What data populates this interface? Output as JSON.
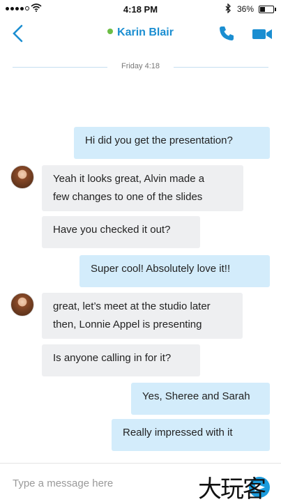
{
  "status_bar": {
    "time": "4:18 PM",
    "battery": "36%",
    "battery_level": 0.36
  },
  "header": {
    "contact_name": "Karin Blair",
    "presence_color": "#6cbd45",
    "accent_color": "#1b8ed1"
  },
  "date_divider": "Friday 4:18",
  "messages": [
    {
      "direction": "outgoing",
      "text": "Hi did you get the presentation?"
    },
    {
      "direction": "incoming",
      "lines": [
        "Yeah it looks great, Alvin made a",
        "few changes to one of the slides"
      ]
    },
    {
      "direction": "incoming",
      "text": "Have you checked it out?"
    },
    {
      "direction": "outgoing",
      "text": "Super cool! Absolutely love it!!"
    },
    {
      "direction": "incoming",
      "lines": [
        "great, let’s meet at the studio later",
        "then, Lonnie Appel is presenting"
      ]
    },
    {
      "direction": "incoming",
      "text": "Is anyone calling in for it?"
    },
    {
      "direction": "outgoing",
      "text": "Yes, Sheree and Sarah"
    },
    {
      "direction": "outgoing",
      "text": "Really impressed with it"
    }
  ],
  "composer": {
    "placeholder": "Type a message here"
  },
  "watermark": "大玩客",
  "colors": {
    "outgoing_bubble": "#d3ecfb",
    "incoming_bubble": "#eeeff1"
  },
  "icons": {
    "back": "chevron-left-icon",
    "call": "phone-icon",
    "video": "video-camera-icon",
    "send": "send-icon"
  }
}
